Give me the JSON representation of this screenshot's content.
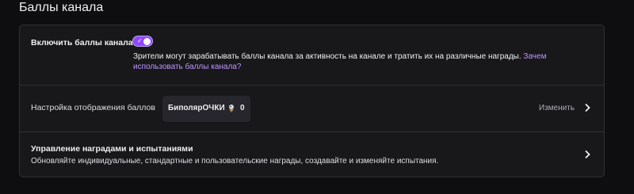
{
  "section": {
    "title": "Баллы канала"
  },
  "enable": {
    "label": "Включить баллы канала",
    "toggle_on": true,
    "description": "Зрители могут зарабатывать баллы канала за активность на канале и тратить их на различные награды. ",
    "link": "Зачем использовать баллы канала?"
  },
  "display": {
    "label": "Настройка отображения баллов",
    "points_name": "БиполярОЧКИ",
    "points_count": "0",
    "points_icon": "custom-points-icon",
    "change_label": "Изменить"
  },
  "rewards": {
    "label": "Управление наградами и испытаниями",
    "description": "Обновляйте индивидуальные, стандартные и пользовательские награды, создавайте и изменяйте испытания."
  },
  "colors": {
    "accent": "#9147ff",
    "link": "#bf94ff",
    "background": "#0e0e10",
    "card": "#18181b"
  }
}
